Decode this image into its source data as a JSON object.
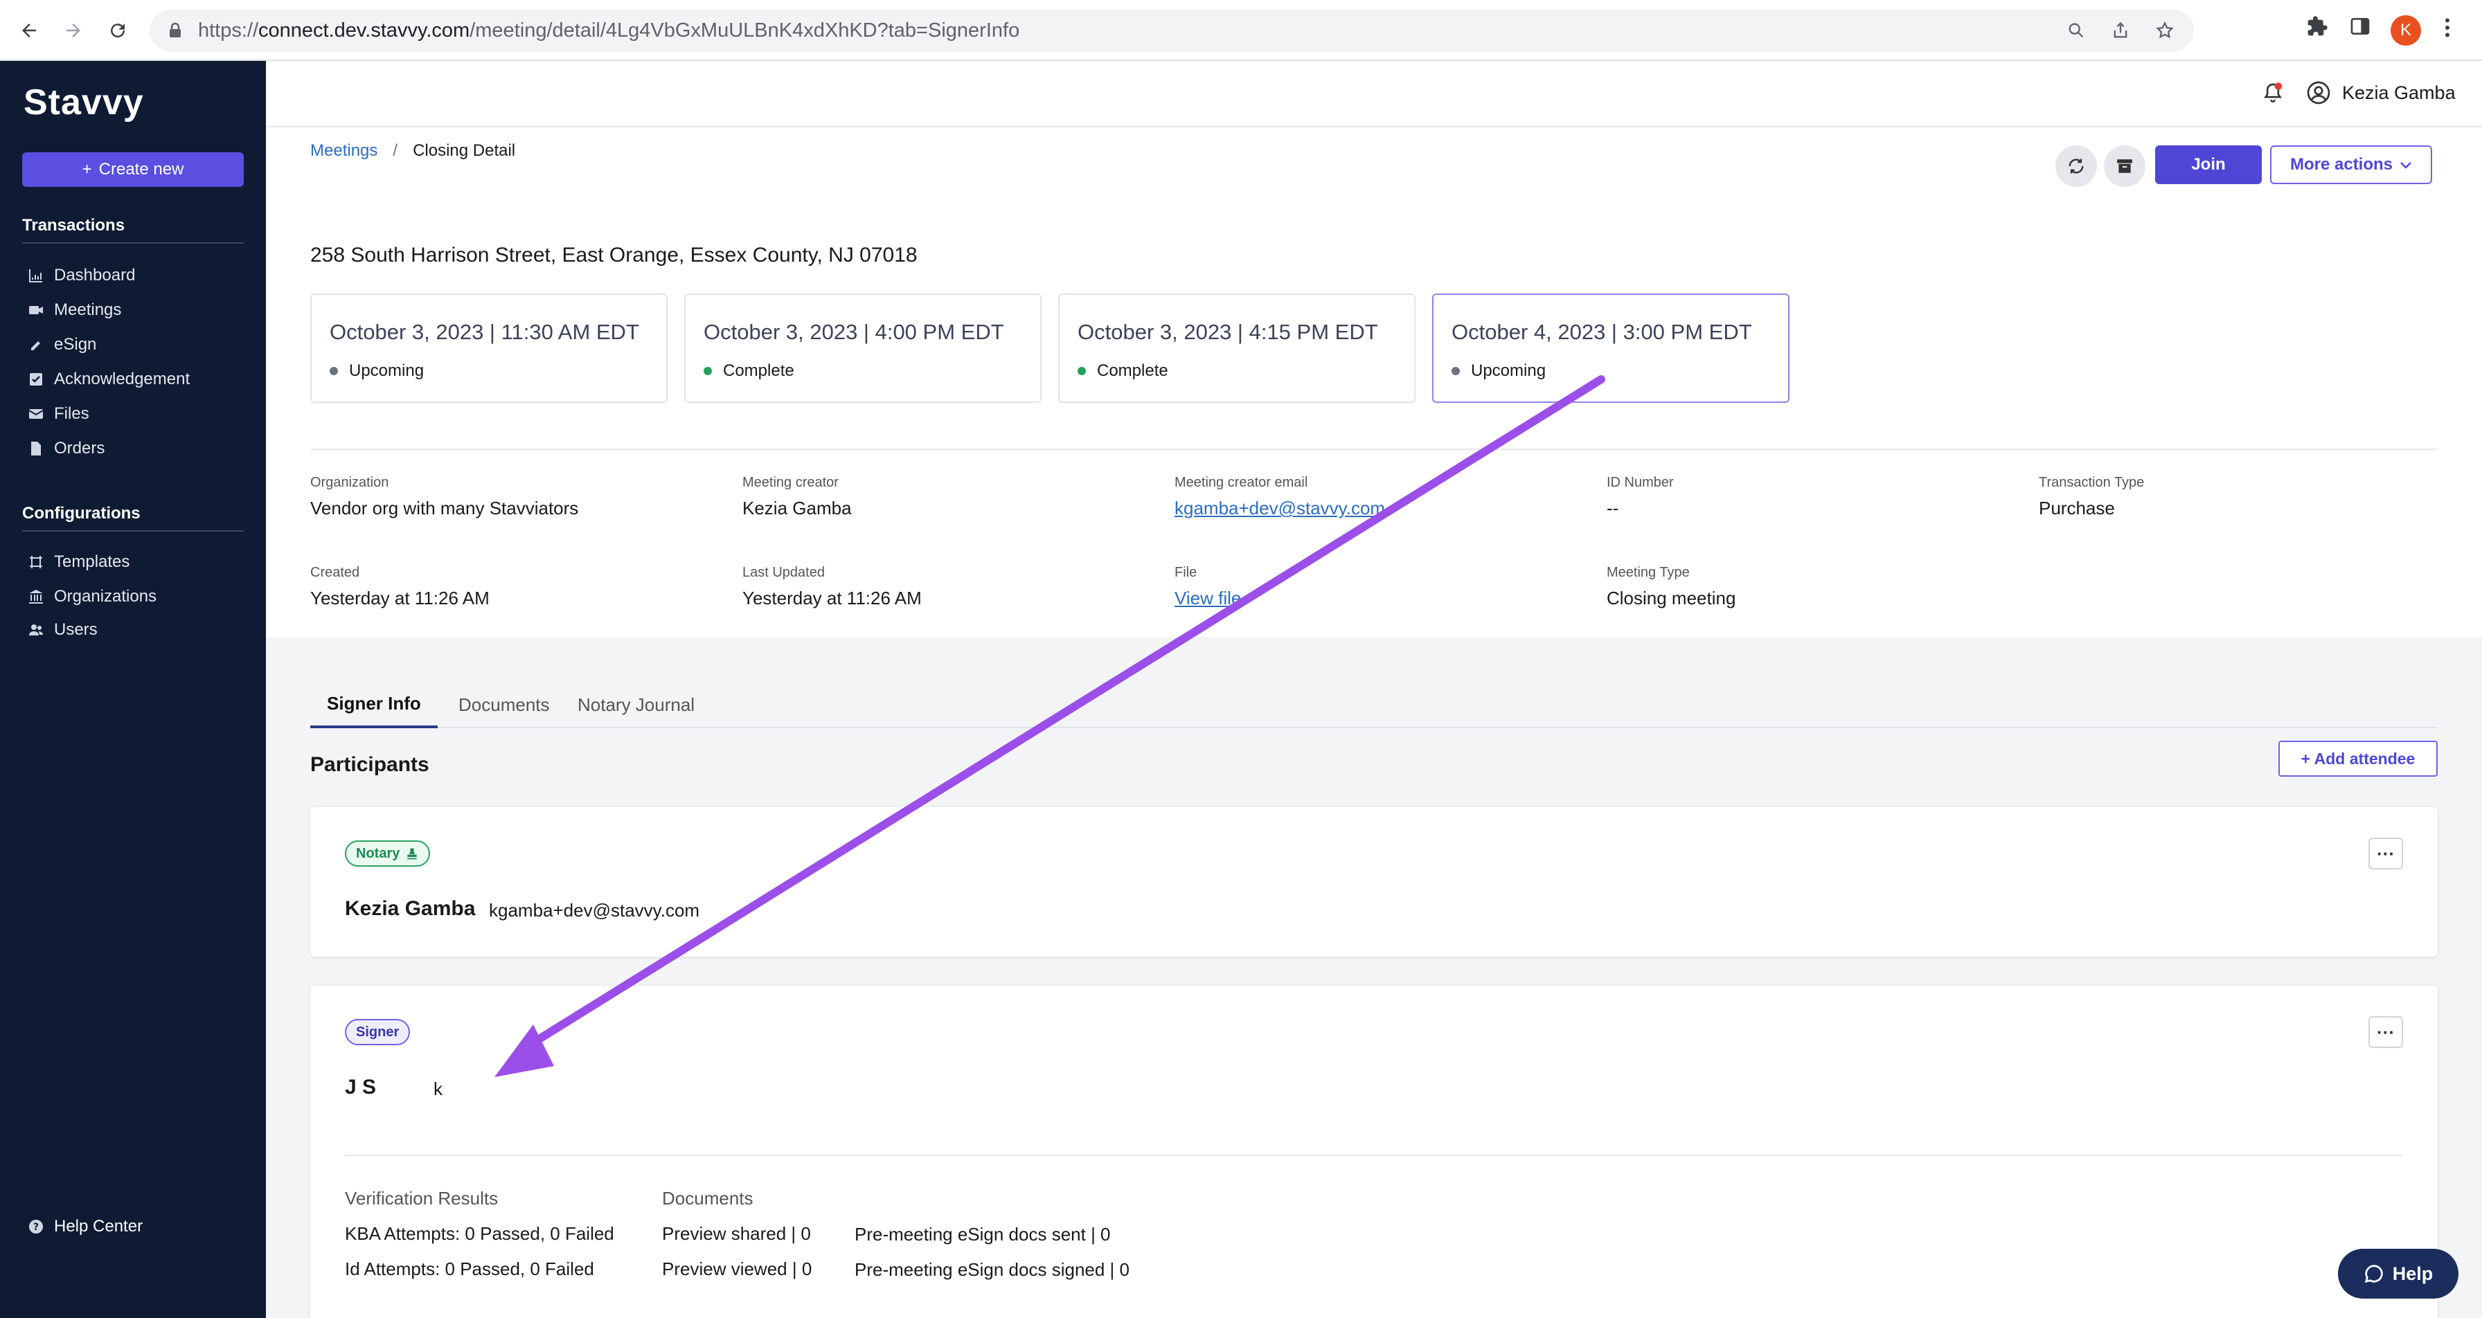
{
  "browser": {
    "url_prefix": "https://",
    "url_host": "connect.dev.stavvy.com",
    "url_path": "/meeting/detail/4Lg4VbGxMuULBnK4xdXhKD?tab=SignerInfo",
    "profile_initial": "K"
  },
  "sidebar": {
    "logo": "Stavvy",
    "create_label": "Create new",
    "transactions_heading": "Transactions",
    "transactions_items": [
      {
        "label": "Dashboard",
        "icon": "chart-icon"
      },
      {
        "label": "Meetings",
        "icon": "video-icon"
      },
      {
        "label": "eSign",
        "icon": "signature-icon"
      },
      {
        "label": "Acknowledgement",
        "icon": "checkbox-icon"
      },
      {
        "label": "Files",
        "icon": "envelope-icon"
      },
      {
        "label": "Orders",
        "icon": "file-icon"
      }
    ],
    "config_heading": "Configurations",
    "config_items": [
      {
        "label": "Templates",
        "icon": "template-icon"
      },
      {
        "label": "Organizations",
        "icon": "bank-icon"
      },
      {
        "label": "Users",
        "icon": "users-icon"
      }
    ],
    "help_center": "Help Center"
  },
  "topbar": {
    "user_name": "Kezia Gamba"
  },
  "breadcrumb": {
    "root": "Meetings",
    "sep": "/",
    "current": "Closing Detail"
  },
  "actions": {
    "join": "Join",
    "more": "More actions"
  },
  "address": "258 South Harrison Street, East Orange, Essex County, NJ 07018",
  "meetings": [
    {
      "when": "October 3, 2023 | 11:30 AM EDT",
      "status": "Upcoming",
      "dot": "#6b7280"
    },
    {
      "when": "October 3, 2023 | 4:00 PM EDT",
      "status": "Complete",
      "dot": "#22a05a"
    },
    {
      "when": "October 3, 2023 | 4:15 PM EDT",
      "status": "Complete",
      "dot": "#22a05a"
    },
    {
      "when": "October 4, 2023 | 3:00 PM EDT",
      "status": "Upcoming",
      "dot": "#6b7280"
    }
  ],
  "meta": {
    "organization": {
      "label": "Organization",
      "value": "Vendor org with many Stavviators"
    },
    "creator": {
      "label": "Meeting creator",
      "value": "Kezia Gamba"
    },
    "creator_email": {
      "label": "Meeting creator email",
      "value": "kgamba+dev@stavvy.com"
    },
    "id_number": {
      "label": "ID Number",
      "value": "--"
    },
    "transaction_type": {
      "label": "Transaction Type",
      "value": "Purchase"
    },
    "created": {
      "label": "Created",
      "value": "Yesterday at 11:26 AM"
    },
    "last_updated": {
      "label": "Last Updated",
      "value": "Yesterday at 11:26 AM"
    },
    "file": {
      "label": "File",
      "value": "View file"
    },
    "meeting_type": {
      "label": "Meeting Type",
      "value": "Closing meeting"
    }
  },
  "tabs": [
    "Signer Info",
    "Documents",
    "Notary Journal"
  ],
  "participants_heading": "Participants",
  "add_attendee": "+ Add attendee",
  "notary": {
    "badge": "Notary",
    "name": "Kezia Gamba",
    "email": "kgamba+dev@stavvy.com"
  },
  "signer": {
    "badge": "Signer",
    "name": "J S",
    "email": "k",
    "verification_heading": "Verification Results",
    "kba": "KBA Attempts: 0 Passed, 0 Failed",
    "id": "Id Attempts: 0 Passed, 0 Failed",
    "documents_heading": "Documents",
    "preview_shared": "Preview shared | 0",
    "preview_viewed": "Preview viewed | 0",
    "esign_sent": "Pre-meeting eSign docs sent | 0",
    "esign_signed": "Pre-meeting eSign docs signed | 0"
  },
  "help_button": "Help",
  "colors": {
    "sidebar": "#0f1b33",
    "accent": "#4f46d6",
    "arrow": "#9b4fe8"
  }
}
